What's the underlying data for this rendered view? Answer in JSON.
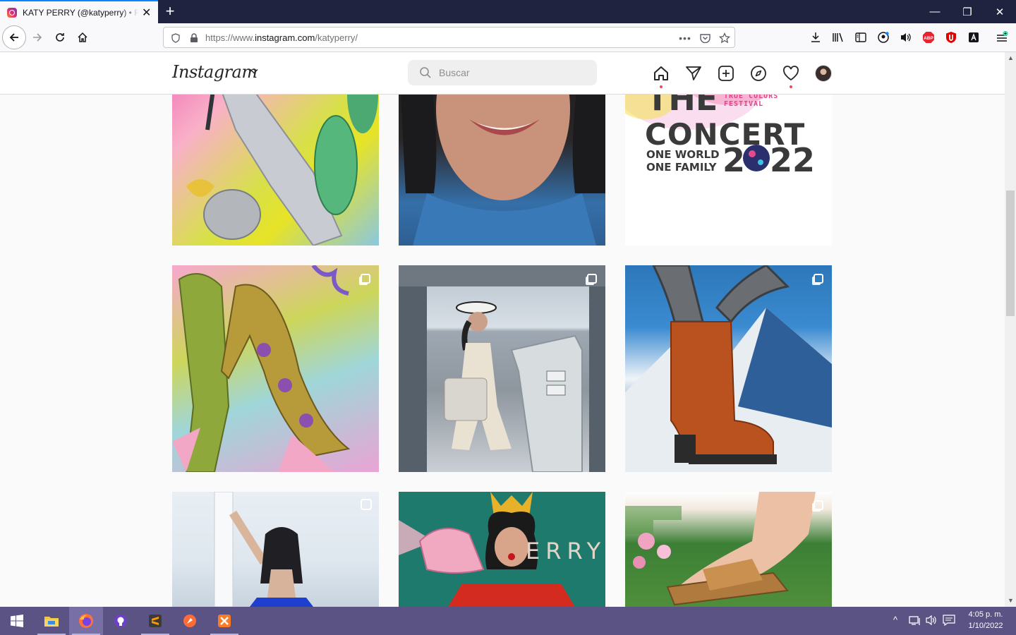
{
  "browser": {
    "tab_title": "KATY PERRY (@katyperry) • Fotos y videos de Instagram",
    "url_prefix": "https://www.",
    "url_domain": "instagram.com",
    "url_path": "/katyperry/",
    "icons": {
      "back": "arrow-left-icon",
      "forward": "arrow-right-icon",
      "reload": "reload-icon",
      "home": "home-icon"
    }
  },
  "instagram": {
    "logo": "Instagram",
    "search_placeholder": "Buscar",
    "nav": [
      "home-icon",
      "direct-icon",
      "new-post-icon",
      "explore-icon",
      "activity-icon",
      "profile-avatar"
    ]
  },
  "posts": [
    {
      "id": "shoe-cactus",
      "type": "single"
    },
    {
      "id": "face-closeup",
      "type": "single"
    },
    {
      "id": "the-concert",
      "type": "single",
      "text": {
        "line1": "THE",
        "festival": "TRUE COLORS FESTIVAL",
        "line2": "CONCERT",
        "line3a": "ONE WORLD",
        "line3b": "ONE FAMILY",
        "year_a": "2",
        "year_b": "22"
      }
    },
    {
      "id": "floral-pump",
      "type": "multi"
    },
    {
      "id": "ship-bridge",
      "type": "multi"
    },
    {
      "id": "orange-boot",
      "type": "multi"
    },
    {
      "id": "blue-dress",
      "type": "reel"
    },
    {
      "id": "perry-crown",
      "type": "single",
      "text": {
        "brand": "ERRY"
      }
    },
    {
      "id": "garden-sandal",
      "type": "multi"
    }
  ],
  "taskbar": {
    "time": "4:05 p. m.",
    "date": "1/10/2022",
    "apps": [
      "windows-start-icon",
      "file-explorer-icon",
      "firefox-icon",
      "github-desktop-icon",
      "sublime-text-icon",
      "postman-icon",
      "xampp-icon"
    ]
  },
  "colors": {
    "titlebar": "#202340",
    "taskbar": "#5a5383",
    "notification_dot": "#ed4956",
    "accent": "#0a84ff"
  }
}
